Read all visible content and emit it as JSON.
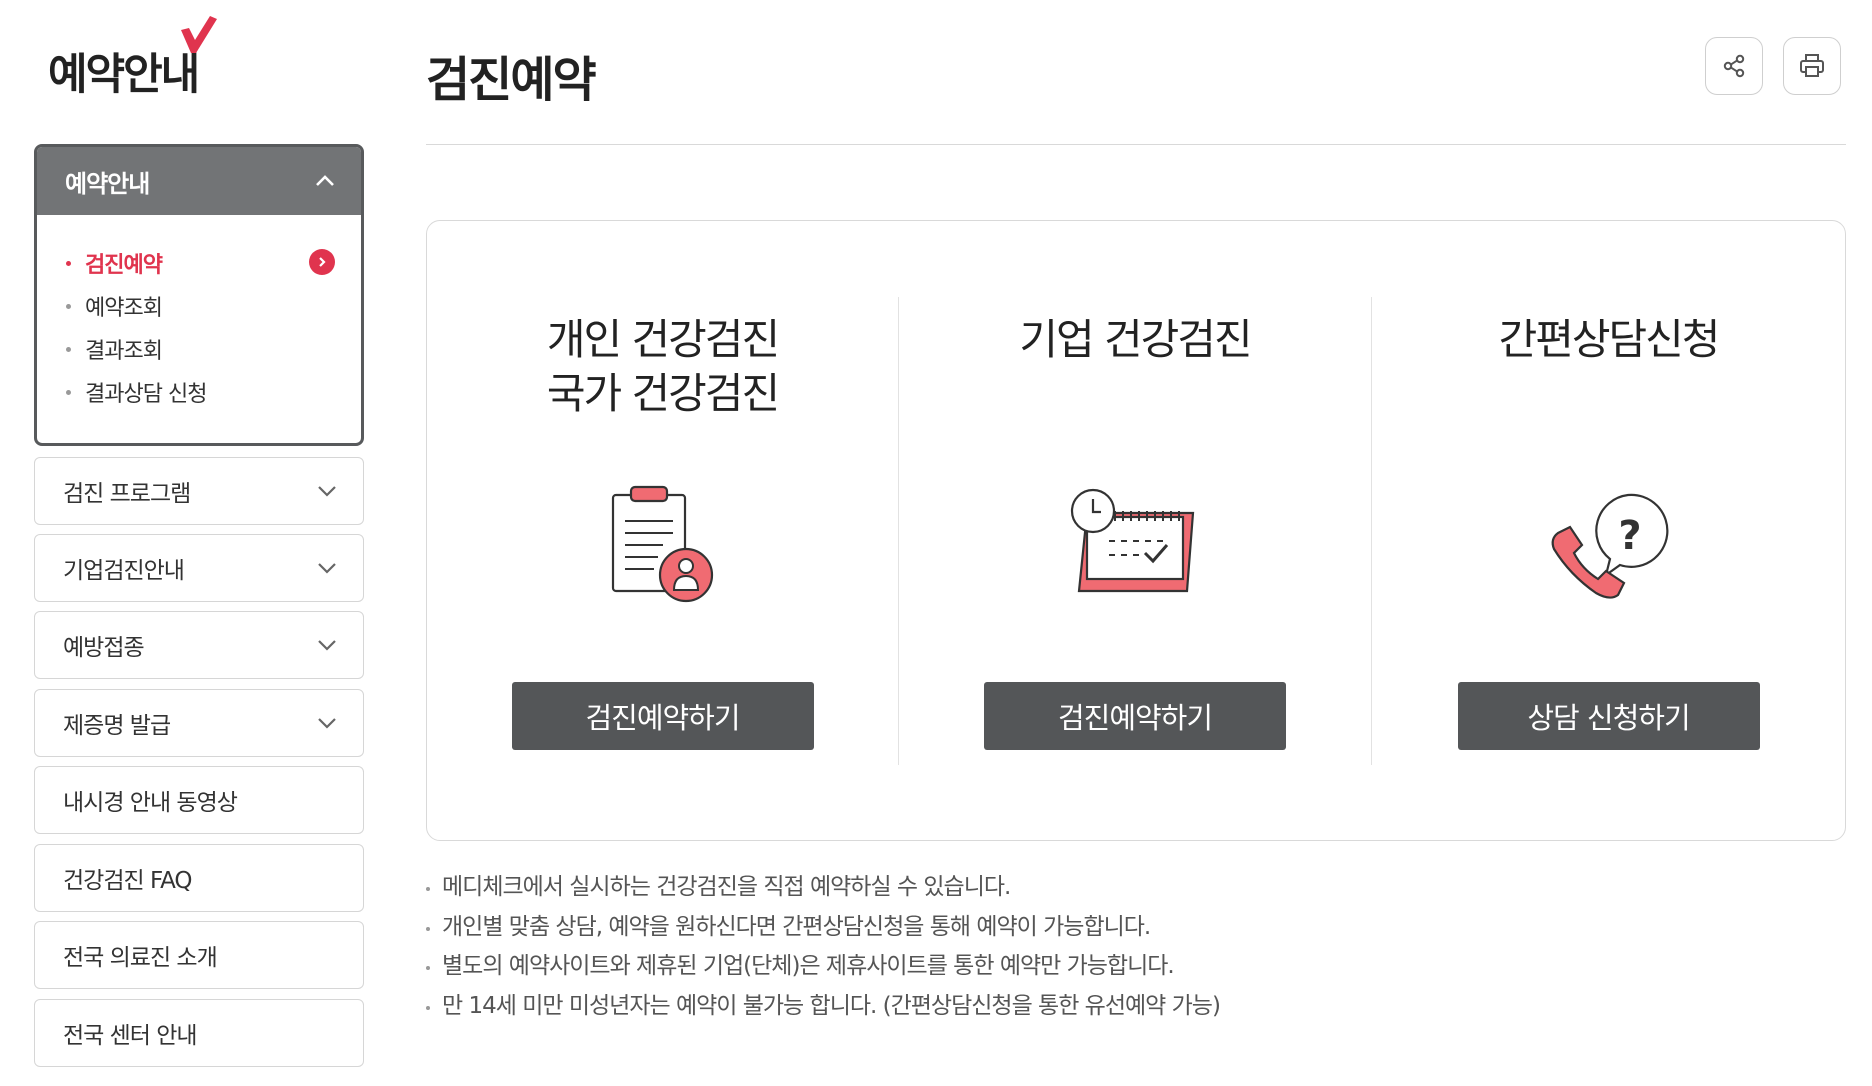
{
  "brand": {
    "logo_text": "예약안내",
    "accent": "#e0344e"
  },
  "header": {
    "title": "검진예약",
    "share_icon": "share-icon",
    "print_icon": "print-icon"
  },
  "sidebar": {
    "section": {
      "title": "예약안내",
      "items": [
        {
          "label": "검진예약",
          "active": true
        },
        {
          "label": "예약조회"
        },
        {
          "label": "결과조회"
        },
        {
          "label": "결과상담 신청"
        }
      ]
    },
    "menus": [
      {
        "label": "검진 프로그램",
        "expandable": true
      },
      {
        "label": "기업검진안내",
        "expandable": true
      },
      {
        "label": "예방접종",
        "expandable": true
      },
      {
        "label": "제증명 발급",
        "expandable": true
      },
      {
        "label": "내시경 안내 동영상",
        "expandable": false
      },
      {
        "label": "건강검진 FAQ",
        "expandable": false
      },
      {
        "label": "전국 의료진 소개",
        "expandable": false
      },
      {
        "label": "전국 센터 안내",
        "expandable": false
      }
    ]
  },
  "options": [
    {
      "title_lines": [
        "개인 건강검진",
        "국가 건강검진"
      ],
      "icon": "clipboard-person-icon",
      "button": "검진예약하기"
    },
    {
      "title_lines": [
        "기업 건강검진"
      ],
      "icon": "calendar-clock-icon",
      "button": "검진예약하기"
    },
    {
      "title_lines": [
        "간편상담신청"
      ],
      "icon": "phone-question-icon",
      "button": "상담 신청하기"
    }
  ],
  "notes": [
    "메디체크에서 실시하는 건강검진을 직접 예약하실 수 있습니다.",
    "개인별 맞춤 상담, 예약을 원하신다면 간편상담신청을 통해 예약이 가능합니다.",
    "별도의 예약사이트와 제휴된 기업(단체)은 제휴사이트를 통한 예약만 가능합니다.",
    "만 14세 미만 미성년자는 예약이 불가능 합니다. (간편상담신청을 통한 유선예약 가능)"
  ]
}
